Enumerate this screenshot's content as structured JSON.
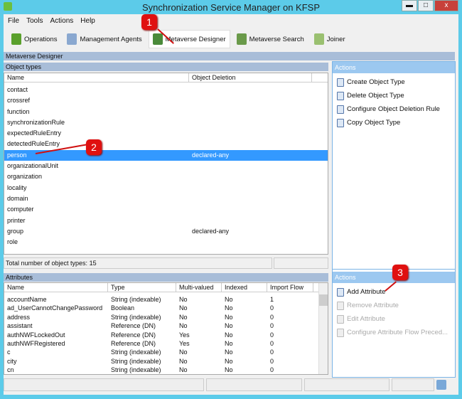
{
  "window": {
    "title": "Synchronization Service Manager on KFSP",
    "minimize": "▬",
    "maximize": "□",
    "close": "x"
  },
  "menu": [
    "File",
    "Tools",
    "Actions",
    "Help"
  ],
  "toolbar": [
    "Operations",
    "Management Agents",
    "Metaverse Designer",
    "Metaverse Search",
    "Joiner"
  ],
  "section_title": "Metaverse Designer",
  "object_types": {
    "header": "Object types",
    "columns": [
      "Name",
      "Object Deletion"
    ],
    "rows": [
      [
        "contact",
        ""
      ],
      [
        "crossref",
        ""
      ],
      [
        "function",
        ""
      ],
      [
        "synchronizationRule",
        ""
      ],
      [
        "expectedRuleEntry",
        ""
      ],
      [
        "detectedRuleEntry",
        ""
      ],
      [
        "person",
        "declared-any"
      ],
      [
        "organizationalUnit",
        ""
      ],
      [
        "organization",
        ""
      ],
      [
        "locality",
        ""
      ],
      [
        "domain",
        ""
      ],
      [
        "computer",
        ""
      ],
      [
        "printer",
        ""
      ],
      [
        "group",
        "declared-any"
      ],
      [
        "role",
        ""
      ]
    ],
    "selected": "person",
    "total": "Total number of object types: 15"
  },
  "attributes": {
    "header": "Attributes",
    "columns": [
      "Name",
      "Type",
      "Multi-valued",
      "Indexed",
      "Import Flow"
    ],
    "rows": [
      [
        "accountName",
        "String (indexable)",
        "No",
        "No",
        "1"
      ],
      [
        "ad_UserCannotChangePassword",
        "Boolean",
        "No",
        "No",
        "0"
      ],
      [
        "address",
        "String (indexable)",
        "No",
        "No",
        "0"
      ],
      [
        "assistant",
        "Reference (DN)",
        "No",
        "No",
        "0"
      ],
      [
        "authNWFLockedOut",
        "Reference (DN)",
        "Yes",
        "No",
        "0"
      ],
      [
        "authNWFRegistered",
        "Reference (DN)",
        "Yes",
        "No",
        "0"
      ],
      [
        "c",
        "String (indexable)",
        "No",
        "No",
        "0"
      ],
      [
        "city",
        "String (indexable)",
        "No",
        "No",
        "0"
      ],
      [
        "cn",
        "String (indexable)",
        "No",
        "No",
        "0"
      ]
    ]
  },
  "actions_top": {
    "header": "Actions",
    "items": [
      "Create Object Type",
      "Delete Object Type",
      "Configure Object Deletion Rule",
      "Copy Object Type"
    ]
  },
  "actions_bottom": {
    "header": "Actions",
    "items": [
      "Add Attribute",
      "Remove Attribute",
      "Edit Attribute",
      "Configure Attribute Flow Preced..."
    ]
  },
  "callouts": [
    "1",
    "2",
    "3"
  ]
}
